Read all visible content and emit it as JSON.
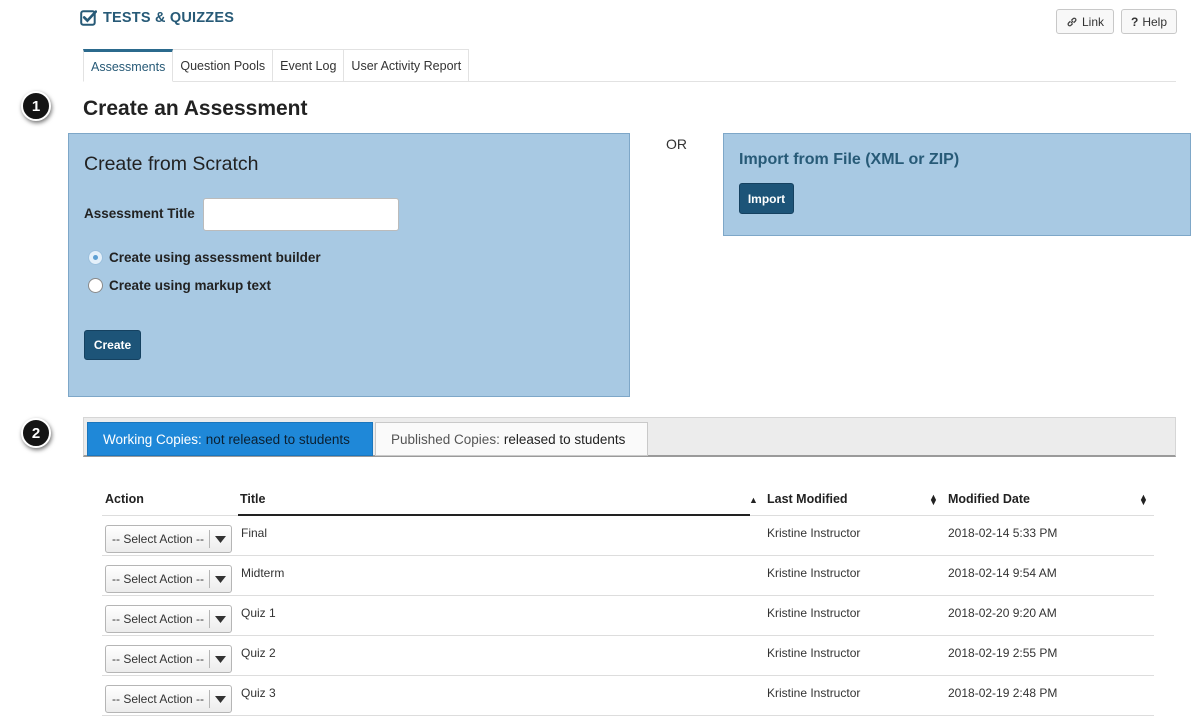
{
  "header": {
    "tool_title": "TESTS & QUIZZES",
    "link_label": "Link",
    "help_label": "Help"
  },
  "nav_tabs": [
    {
      "label": "Assessments",
      "active": true
    },
    {
      "label": "Question Pools",
      "active": false
    },
    {
      "label": "Event Log",
      "active": false
    },
    {
      "label": "User Activity Report",
      "active": false
    }
  ],
  "steps": {
    "one": "1",
    "two": "2"
  },
  "create": {
    "heading": "Create an Assessment",
    "scratch_title": "Create from Scratch",
    "assessment_title_label": "Assessment Title",
    "assessment_title_value": "",
    "radio_builder": "Create using assessment builder",
    "radio_markup": "Create using markup text",
    "selected_radio": "builder",
    "create_button": "Create",
    "or_text": "OR",
    "import_title": "Import from File (XML or ZIP)",
    "import_button": "Import"
  },
  "copy_tabs": {
    "working_prefix": "Working Copies:",
    "working_suffix": "not released to students",
    "published_prefix": "Published Copies:",
    "published_suffix": "released to students",
    "active": "working"
  },
  "table": {
    "headers": {
      "action": "Action",
      "title": "Title",
      "last_modified": "Last Modified",
      "modified_date": "Modified Date"
    },
    "select_placeholder": "-- Select Action --",
    "rows": [
      {
        "title": "Final",
        "last_modified": "Kristine Instructor",
        "modified_date": "2018-02-14 5:33 PM"
      },
      {
        "title": "Midterm",
        "last_modified": "Kristine Instructor",
        "modified_date": "2018-02-14 9:54 AM"
      },
      {
        "title": "Quiz 1",
        "last_modified": "Kristine Instructor",
        "modified_date": "2018-02-20 9:20 AM"
      },
      {
        "title": "Quiz 2",
        "last_modified": "Kristine Instructor",
        "modified_date": "2018-02-19 2:55 PM"
      },
      {
        "title": "Quiz 3",
        "last_modified": "Kristine Instructor",
        "modified_date": "2018-02-19 2:48 PM"
      }
    ]
  },
  "colors": {
    "panel_bg": "#a8c9e3",
    "dark_button": "#1d5478",
    "active_tab_blue": "#1f88d8",
    "title_blue": "#275a77"
  },
  "icons": {
    "tool": "check-square-icon",
    "link": "link-icon",
    "help": "question-icon",
    "sort_asc": "sort-up-icon",
    "sort_both": "sort-icon",
    "dropdown": "caret-down-icon"
  }
}
